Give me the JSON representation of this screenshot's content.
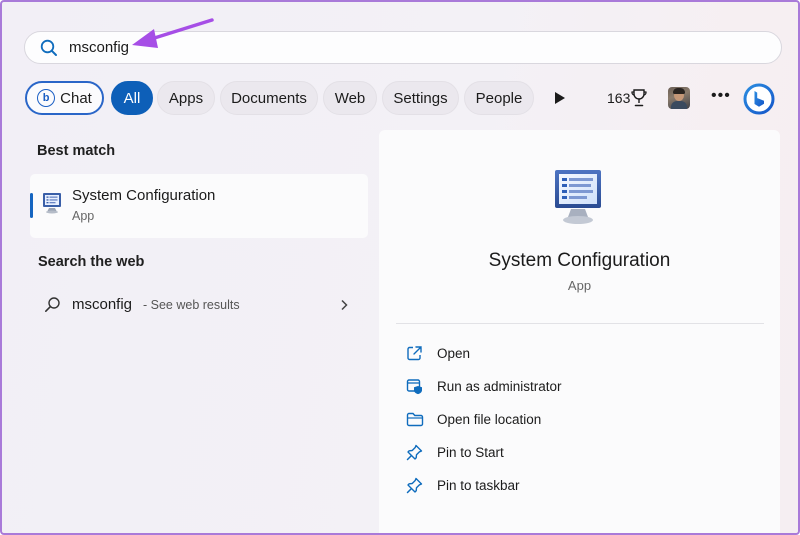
{
  "search": {
    "value": "msconfig"
  },
  "filters": {
    "chat": "Chat",
    "all": "All",
    "apps": "Apps",
    "documents": "Documents",
    "web": "Web",
    "settings": "Settings",
    "people": "People",
    "rewards_count": "163",
    "more": "•••"
  },
  "best_match": {
    "heading": "Best match",
    "name": "System Configuration",
    "type": "App"
  },
  "web": {
    "heading": "Search the web",
    "query": "msconfig",
    "suffix": "- See web results"
  },
  "detail": {
    "title": "System Configuration",
    "type": "App",
    "actions": [
      {
        "label": "Open",
        "icon": "open-external-icon"
      },
      {
        "label": "Run as administrator",
        "icon": "shield-admin-icon"
      },
      {
        "label": "Open file location",
        "icon": "folder-icon"
      },
      {
        "label": "Pin to Start",
        "icon": "pin-icon"
      },
      {
        "label": "Pin to taskbar",
        "icon": "pin-icon"
      }
    ]
  },
  "colors": {
    "accent": "#0d5fb8",
    "arrow": "#a64ee6",
    "frame": "#a97ad9"
  }
}
